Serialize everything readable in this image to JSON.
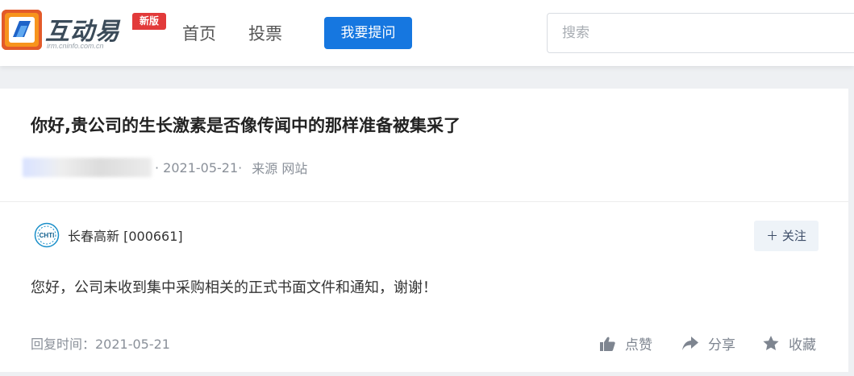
{
  "header": {
    "logo_text": "互动易",
    "logo_subtitle": "irm.cninfo.com.cn",
    "logo_badge": "新版",
    "nav": [
      {
        "label": "首页"
      },
      {
        "label": "投票"
      }
    ],
    "ask_button": "我要提问",
    "search_placeholder": "搜索"
  },
  "question": {
    "title": "你好,贵公司的生长激素是否像传闻中的那样准备被集采了",
    "date": "· 2021-05-21·",
    "source": "来源 网站"
  },
  "answer": {
    "company": "长春高新 [000661]",
    "company_logo_text": "CHTI",
    "follow_label": "＋ 关注",
    "content": "您好，公司未收到集中采购相关的正式书面文件和通知，谢谢！",
    "reply_time": "回复时间：2021-05-21",
    "actions": [
      {
        "label": "点赞",
        "icon": "thumbs-up-icon"
      },
      {
        "label": "分享",
        "icon": "share-icon"
      },
      {
        "label": "收藏",
        "icon": "star-icon"
      }
    ]
  },
  "colors": {
    "primary": "#1677e0",
    "badge": "#e23a3a",
    "logo_orange": "#e25b2b"
  }
}
